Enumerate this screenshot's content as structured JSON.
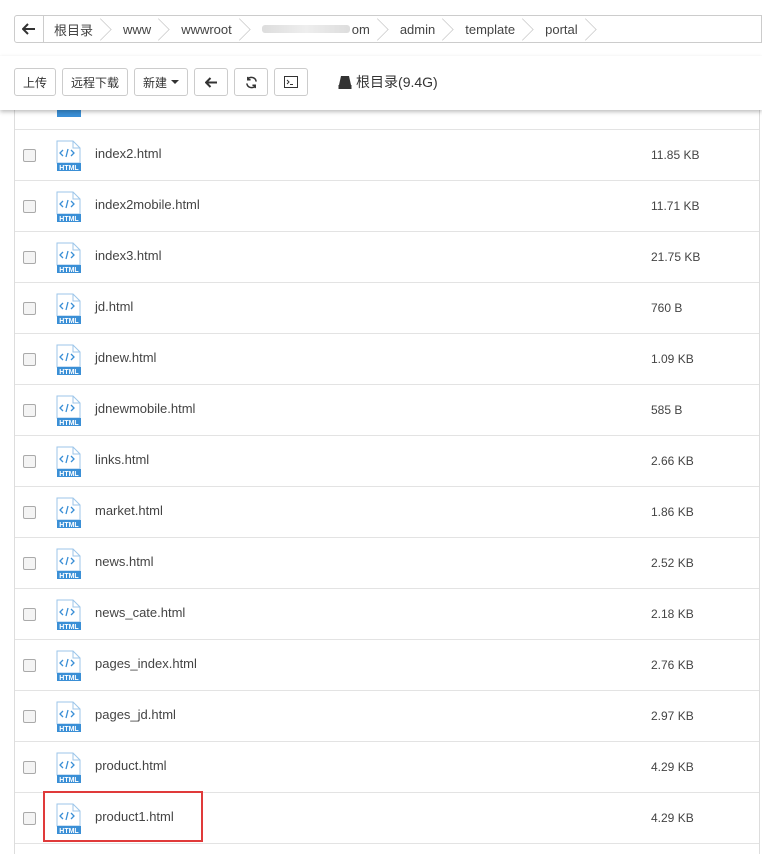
{
  "breadcrumb": {
    "items": [
      "根目录",
      "www",
      "wwwroot",
      "om",
      "admin",
      "template",
      "portal"
    ]
  },
  "toolbar": {
    "upload_label": "上传",
    "remote_download_label": "远程下载",
    "new_label": "新建",
    "disk_label": "根目录(9.4G)"
  },
  "file_icon_text": "HTML",
  "files": [
    {
      "name": "index2.html",
      "size": "11.85 KB"
    },
    {
      "name": "index2mobile.html",
      "size": "11.71 KB"
    },
    {
      "name": "index3.html",
      "size": "21.75 KB"
    },
    {
      "name": "jd.html",
      "size": "760 B"
    },
    {
      "name": "jdnew.html",
      "size": "1.09 KB"
    },
    {
      "name": "jdnewmobile.html",
      "size": "585 B"
    },
    {
      "name": "links.html",
      "size": "2.66 KB"
    },
    {
      "name": "market.html",
      "size": "1.86 KB"
    },
    {
      "name": "news.html",
      "size": "2.52 KB"
    },
    {
      "name": "news_cate.html",
      "size": "2.18 KB"
    },
    {
      "name": "pages_index.html",
      "size": "2.76 KB"
    },
    {
      "name": "pages_jd.html",
      "size": "2.97 KB"
    },
    {
      "name": "product.html",
      "size": "4.29 KB"
    },
    {
      "name": "product1.html",
      "size": "4.29 KB"
    }
  ],
  "colors": {
    "icon_blue": "#3a8fd6",
    "highlight_red": "#e03a3a"
  }
}
